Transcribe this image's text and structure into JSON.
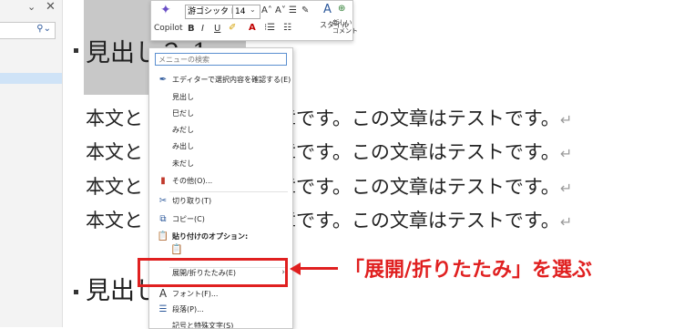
{
  "nav_pane": {},
  "document": {
    "heading1": "見出し２-1",
    "heading2": "見出し",
    "body_line": "本文と　　　　　　文章です。この文章はテストです。",
    "paragraph_mark": "↵"
  },
  "mini_toolbar": {
    "copilot_label": "Copilot",
    "font_name": "游ゴシック Li",
    "font_size": "14",
    "bold": "B",
    "italic": "I",
    "underline": "U",
    "style_label": "スタイル",
    "new_comment_label": "新しい\nコメント"
  },
  "context_menu": {
    "search_placeholder": "メニューの検索",
    "editor_confirm": "エディターで選択内容を確認する(E)",
    "style_items": [
      "見出し",
      "巳だし",
      "みだし",
      "み出し",
      "未だし"
    ],
    "other": "その他(O)...",
    "cut": "切り取り(T)",
    "copy": "コピー(C)",
    "paste_options": "貼り付けのオプション:",
    "expand_collapse": "展開/折りたたみ(E)",
    "font": "フォント(F)...",
    "paragraph": "段落(P)...",
    "symbols": "記号と特殊文字(S)"
  },
  "annotation": {
    "text": "「展開/折りたたみ」を選ぶ",
    "color": "#e02020"
  }
}
